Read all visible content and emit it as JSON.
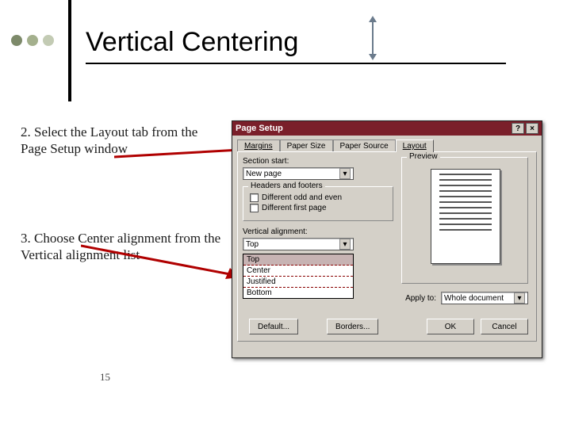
{
  "slide": {
    "title": "Vertical Centering",
    "step2": "2.  Select the Layout tab from the Page Setup window",
    "step3": "3.  Choose Center alignment from the Vertical alignment list",
    "page_number": "15"
  },
  "dialog": {
    "title": "Page Setup",
    "help_btn": "?",
    "close_btn": "×",
    "tabs": {
      "margins": "Margins",
      "paper_size": "Paper Size",
      "paper_source": "Paper Source",
      "layout": "Layout"
    },
    "section_start_label": "Section start:",
    "section_start_value": "New page",
    "headers_footers_legend": "Headers and footers",
    "diff_odd_even": "Different odd and even",
    "diff_first": "Different first page",
    "vertical_alignment_label": "Vertical alignment:",
    "vertical_alignment_value": "Top",
    "vertical_alignment_options": {
      "o0": "Top",
      "o1": "Center",
      "o2": "Justified",
      "o3": "Bottom"
    },
    "preview_label": "Preview",
    "apply_to_label": "Apply to:",
    "apply_to_value": "Whole document",
    "default_btn": "Default...",
    "borders_btn": "Borders...",
    "ok_btn": "OK",
    "cancel_btn": "Cancel"
  }
}
